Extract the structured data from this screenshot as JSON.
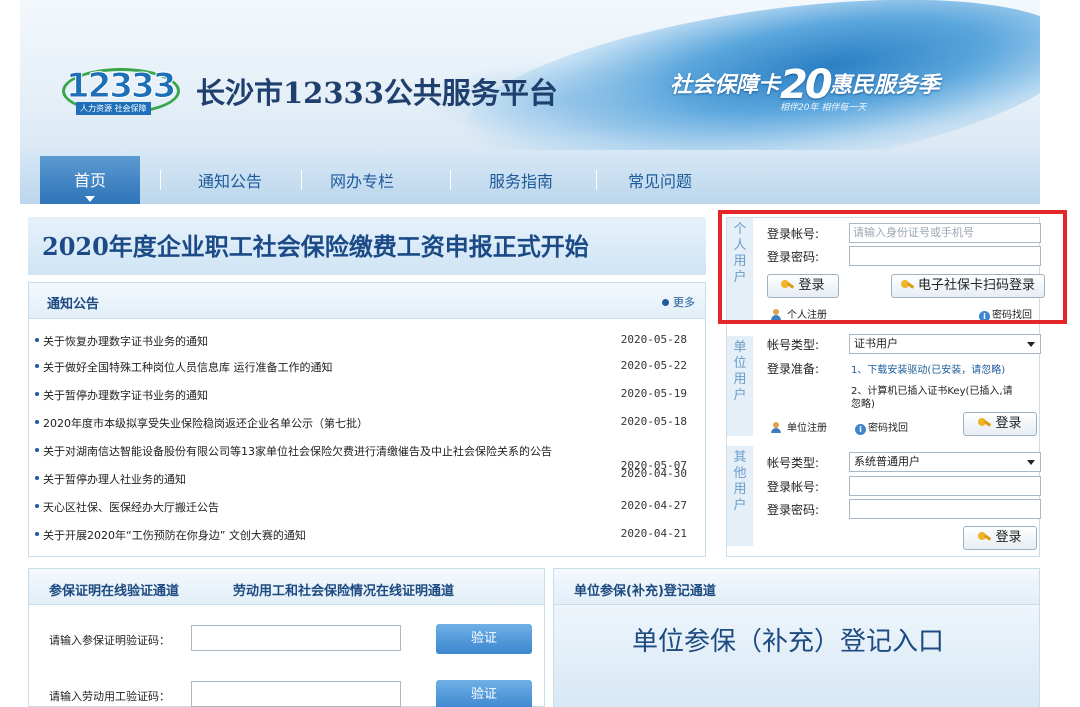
{
  "header": {
    "logo_number": "12333",
    "logo_tag": "人力资源 社会保障",
    "site_title": "长沙市12333公共服务平台",
    "slogan_pre": "社会保障卡",
    "slogan_20": "20",
    "slogan_post": "惠民服务季",
    "slogan_sub": "相伴20年 相伴每一天"
  },
  "nav": {
    "items": [
      "首页",
      "通知公告",
      "网办专栏",
      "服务指南",
      "常见问题"
    ]
  },
  "headline": "2020年度企业职工社会保险缴费工资申报正式开始",
  "notices": {
    "title": "通知公告",
    "more": "更多",
    "items": [
      {
        "text": "关于恢复办理数字证书业务的通知",
        "date": "2020-05-28"
      },
      {
        "text": "关于做好全国特殊工种岗位人员信息库 运行准备工作的通知",
        "date": "2020-05-22"
      },
      {
        "text": "关于暂停办理数字证书业务的通知",
        "date": "2020-05-19"
      },
      {
        "text": "2020年度市本级拟享受失业保险稳岗返还企业名单公示（第七批）",
        "date": "2020-05-18"
      },
      {
        "text": "关于对湖南信达智能设备股份有限公司等13家单位社会保险欠费进行清缴催告及中止社会保险关系的公告",
        "date": "2020-05-07"
      },
      {
        "text": "关于暂停办理人社业务的通知",
        "date": "2020-04-30"
      },
      {
        "text": "天心区社保、医保经办大厅搬迁公告",
        "date": "2020-04-27"
      },
      {
        "text": "关于开展2020年“工伤预防在你身边” 文创大赛的通知",
        "date": "2020-04-21"
      }
    ]
  },
  "personal": {
    "tab": [
      "个",
      "人",
      "用",
      "户"
    ],
    "account_label": "登录帐号:",
    "account_placeholder": "请输入身份证号或手机号",
    "password_label": "登录密码:",
    "login": "登录",
    "card_login": "电子社保卡扫码登录",
    "register": "个人注册",
    "find_password": "密码找回"
  },
  "unit": {
    "tab": [
      "单",
      "位",
      "用",
      "户"
    ],
    "type_label": "帐号类型:",
    "type_value": "证书用户",
    "prep_label": "登录准备:",
    "prep_1": "1、下载安装驱动(已安装，请忽略)",
    "prep_2a": "2、计算机已插入证书Key(已插入,请",
    "prep_2b": "忽略)",
    "register": "单位注册",
    "find_password": "密码找回",
    "login": "登录"
  },
  "other": {
    "tab": [
      "其",
      "他",
      "用",
      "户"
    ],
    "type_label": "帐号类型:",
    "type_value": "系统普通用户",
    "account_label": "登录帐号:",
    "password_label": "登录密码:",
    "login": "登录"
  },
  "verify": {
    "title1": "参保证明在线验证通道",
    "title2": "劳动用工和社会保险情况在线证明通道",
    "row1_label": "请输入参保证明验证码：",
    "row2_label": "请输入劳动用工验证码：",
    "button": "验证"
  },
  "reg": {
    "title": "单位参保(补充)登记通道",
    "entry": "单位参保（补充）登记入口"
  }
}
